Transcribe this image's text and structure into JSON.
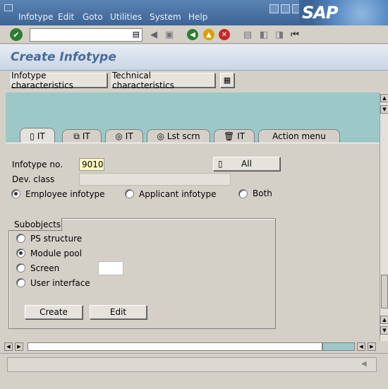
{
  "menubar": {
    "items": [
      "Infotype",
      "Edit",
      "Goto",
      "Utilities",
      "System",
      "Help"
    ],
    "logo": "SAP"
  },
  "toolbar": {
    "command_value": "",
    "icons": [
      "enter-icon",
      "dropdown-icon",
      "back-triangle-icon",
      "save-icon",
      "back-icon",
      "exit-icon",
      "cancel-icon",
      "print-icon",
      "find-icon",
      "find-next-icon",
      "first-page-icon"
    ]
  },
  "title": "Create Infotype",
  "app_toolbar": {
    "btn1": "Infotype characteristics",
    "btn2": "Technical characteristics"
  },
  "tabs": [
    {
      "label": "IT",
      "icon": "document-icon"
    },
    {
      "label": "IT",
      "icon": "copy-icon"
    },
    {
      "label": "IT",
      "icon": "spiral-icon"
    },
    {
      "label": "Lst scrn",
      "icon": "spiral-icon"
    },
    {
      "label": "IT",
      "icon": "trash-icon"
    },
    {
      "label": "Action menu",
      "icon": ""
    }
  ],
  "form": {
    "infotype_label": "Infotype no.",
    "infotype_value": "9010",
    "all_button": "All",
    "devclass_label": "Dev. class",
    "devclass_value": "",
    "radio_employee": "Employee infotype",
    "radio_applicant": "Applicant infotype",
    "radio_both": "Both"
  },
  "subobjects": {
    "title": "Subobjects",
    "options": [
      "PS structure",
      "Module pool",
      "Screen",
      "User interface"
    ],
    "selected": "Module pool",
    "screen_value": "",
    "create_button": "Create",
    "edit_button": "Edit"
  }
}
